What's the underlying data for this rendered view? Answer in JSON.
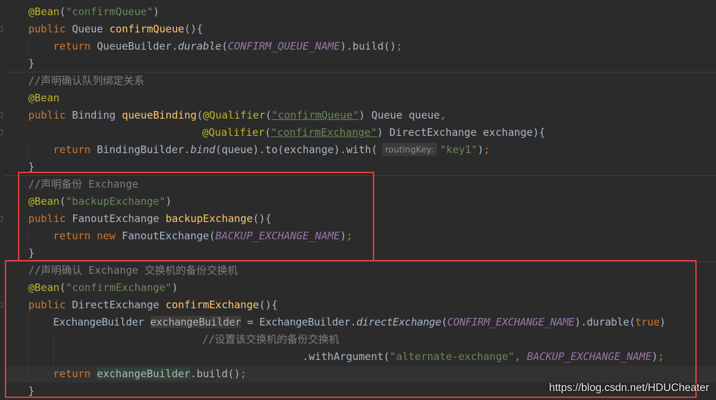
{
  "code": {
    "l1": {
      "ann": "@Bean",
      "p1": "(",
      "str": "\"confirmQueue\"",
      "p2": ")"
    },
    "l2": {
      "kw": "public",
      "type": " Queue ",
      "method": "confirmQueue",
      "rest": "(){"
    },
    "l3": {
      "kw": "return",
      "p1": " QueueBuilder.",
      "call": "durable",
      "p2": "(",
      "const": "CONFIRM_QUEUE_NAME",
      "p3": ").build()",
      "semi": ";"
    },
    "l4": {
      "brace": "}"
    },
    "l5": {
      "comment": "//声明确认队列绑定关系"
    },
    "l6": {
      "ann": "@Bean"
    },
    "l7": {
      "kw": "public",
      "type": " Binding ",
      "method": "queueBinding",
      "p1": "(",
      "ann": "@Qualifier",
      "p2": "(",
      "str": "\"confirmQueue\"",
      "p3": ") Queue queue",
      "comma": ","
    },
    "l8": {
      "ann": "@Qualifier",
      "p1": "(",
      "str": "\"confirmExchange\"",
      "p2": ") DirectExchange exchange){"
    },
    "l9": {
      "kw": "return",
      "p1": " BindingBuilder.",
      "call": "bind",
      "p2": "(queue).to(exchange).with(",
      "hint": "routingKey:",
      "str": "\"key1\"",
      "p3": ")",
      "semi": ";"
    },
    "l10": {
      "brace": "}"
    },
    "l11": {
      "comment": "//声明备份 Exchange"
    },
    "l12": {
      "ann": "@Bean",
      "p1": "(",
      "str": "\"backupExchange\"",
      "p2": ")"
    },
    "l13": {
      "kw": "public",
      "type": " FanoutExchange ",
      "method": "backupExchange",
      "rest": "(){"
    },
    "l14": {
      "kw1": "return",
      "sp": " ",
      "kw2": "new",
      "p1": " FanoutExchange(",
      "const": "BACKUP_EXCHANGE_NAME",
      "p2": ")",
      "semi": ";"
    },
    "l15": {
      "brace": "}"
    },
    "l16": {
      "comment": "//声明确认 Exchange 交换机的备份交换机"
    },
    "l17": {
      "ann": "@Bean",
      "p1": "(",
      "str": "\"confirmExchange\"",
      "p2": ")"
    },
    "l18": {
      "kw": "public",
      "type": " DirectExchange ",
      "method": "confirmExchange",
      "rest": "(){"
    },
    "l19": {
      "p0": "ExchangeBuilder ",
      "var": "exchangeBuilder",
      "p1": " = ExchangeBuilder.",
      "call": "directExchange",
      "p2": "(",
      "const": "CONFIRM_EXCHANGE_NAME",
      "p3": ").durable(",
      "kw": "true",
      "p4": ")"
    },
    "l20": {
      "comment": "//设置该交换机的备份交换机"
    },
    "l21": {
      "p1": ".withArgument(",
      "str": "\"alternate-exchange\"",
      "comma": ", ",
      "const": "BACKUP_EXCHANGE_NAME",
      "p2": ")",
      "semi": ";"
    },
    "l22": {
      "kw": "return",
      "sp": " ",
      "var": "exchangeBuilder",
      "p1": ".build()",
      "semi": ";"
    },
    "l23": {
      "brace": "}"
    }
  },
  "watermark": "https://blog.csdn.net/HDUCheater",
  "colors": {
    "background": "#2b2b2b",
    "keyword": "#cc7832",
    "annotation": "#bbb529",
    "string": "#6a8759",
    "method": "#ffc66d",
    "comment": "#808080",
    "constant": "#9876aa",
    "highlight_box": "#e03e3e"
  }
}
